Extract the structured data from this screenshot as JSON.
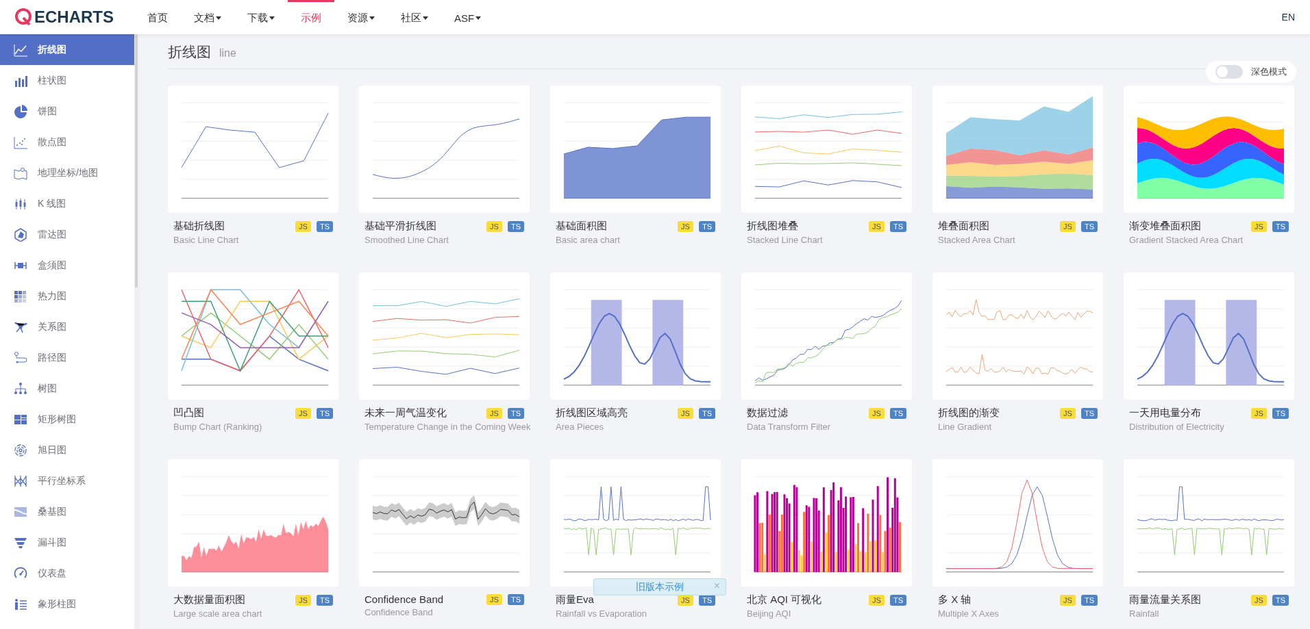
{
  "header": {
    "logo": "ECHARTS",
    "nav": [
      {
        "label": "首页",
        "has_menu": false,
        "selected": false
      },
      {
        "label": "文档",
        "has_menu": true,
        "selected": false
      },
      {
        "label": "下载",
        "has_menu": true,
        "selected": false
      },
      {
        "label": "示例",
        "has_menu": false,
        "selected": true
      },
      {
        "label": "资源",
        "has_menu": true,
        "selected": false
      },
      {
        "label": "社区",
        "has_menu": true,
        "selected": false
      },
      {
        "label": "ASF",
        "has_menu": true,
        "selected": false
      }
    ],
    "language": "EN"
  },
  "sidebar": {
    "items": [
      {
        "label": "折线图",
        "selected": true
      },
      {
        "label": "柱状图",
        "selected": false
      },
      {
        "label": "饼图",
        "selected": false
      },
      {
        "label": "散点图",
        "selected": false
      },
      {
        "label": "地理坐标/地图",
        "selected": false
      },
      {
        "label": "K 线图",
        "selected": false
      },
      {
        "label": "雷达图",
        "selected": false
      },
      {
        "label": "盒须图",
        "selected": false
      },
      {
        "label": "热力图",
        "selected": false
      },
      {
        "label": "关系图",
        "selected": false
      },
      {
        "label": "路径图",
        "selected": false
      },
      {
        "label": "树图",
        "selected": false
      },
      {
        "label": "矩形树图",
        "selected": false
      },
      {
        "label": "旭日图",
        "selected": false
      },
      {
        "label": "平行坐标系",
        "selected": false
      },
      {
        "label": "桑基图",
        "selected": false
      },
      {
        "label": "漏斗图",
        "selected": false
      },
      {
        "label": "仪表盘",
        "selected": false
      },
      {
        "label": "象形柱图",
        "selected": false
      }
    ]
  },
  "section": {
    "title": "折线图",
    "subtitle": "line"
  },
  "dark_mode": {
    "label": "深色模式",
    "on": false
  },
  "cards": [
    {
      "title": "基础折线图",
      "subtitle": "Basic Line Chart",
      "kind": "line",
      "badges": [
        "JS",
        "TS"
      ]
    },
    {
      "title": "基础平滑折线图",
      "subtitle": "Smoothed Line Chart",
      "kind": "smooth",
      "badges": [
        "JS",
        "TS"
      ]
    },
    {
      "title": "基础面积图",
      "subtitle": "Basic area chart",
      "kind": "area",
      "badges": [
        "JS",
        "TS"
      ]
    },
    {
      "title": "折线图堆叠",
      "subtitle": "Stacked Line Chart",
      "kind": "multi",
      "badges": [
        "JS",
        "TS"
      ]
    },
    {
      "title": "堆叠面积图",
      "subtitle": "Stacked Area Chart",
      "kind": "stacked",
      "badges": [
        "JS",
        "TS"
      ]
    },
    {
      "title": "渐变堆叠面积图",
      "subtitle": "Gradient Stacked Area Chart",
      "kind": "waves",
      "badges": [
        "JS",
        "TS"
      ]
    },
    {
      "title": "凹凸图",
      "subtitle": "Bump Chart (Ranking)",
      "kind": "bump",
      "badges": [
        "JS",
        "TS"
      ]
    },
    {
      "title": "未来一周气温变化",
      "subtitle": "Temperature Change in the Coming Week",
      "kind": "multi",
      "badges": [
        "JS",
        "TS"
      ]
    },
    {
      "title": "折线图区域高亮",
      "subtitle": "Area Pieces",
      "kind": "pieces",
      "badges": [
        "JS",
        "TS"
      ]
    },
    {
      "title": "数据过滤",
      "subtitle": "Data Transform Filter",
      "kind": "trend",
      "badges": [
        "JS",
        "TS"
      ]
    },
    {
      "title": "折线图的渐变",
      "subtitle": "Line Gradient",
      "kind": "noise",
      "badges": [
        "JS",
        "TS"
      ]
    },
    {
      "title": "一天用电量分布",
      "subtitle": "Distribution of Electricity",
      "kind": "pieces",
      "badges": [
        "JS",
        "TS"
      ]
    },
    {
      "title": "大数据量面积图",
      "subtitle": "Large scale area chart",
      "kind": "noisearea",
      "badges": [
        "JS",
        "TS"
      ]
    },
    {
      "title": "Confidence Band",
      "subtitle": "Confidence Band",
      "kind": "band",
      "badges": [
        "JS",
        "TS"
      ]
    },
    {
      "title": "雨量Eva",
      "subtitle": "Rainfall vs Evaporation",
      "kind": "spikes",
      "badges": [
        "JS",
        "TS"
      ]
    },
    {
      "title": "北京 AQI 可视化",
      "subtitle": "Beijing AQI",
      "kind": "aqi",
      "badges": [
        "JS",
        "TS"
      ]
    },
    {
      "title": "多 X 轴",
      "subtitle": "Multiple X Axes",
      "kind": "peak",
      "badges": [
        "JS",
        "TS"
      ]
    },
    {
      "title": "雨量流量关系图",
      "subtitle": "Rainfall",
      "kind": "spikes",
      "badges": [
        "JS",
        "TS"
      ]
    }
  ],
  "toast": {
    "text": "旧版本示例",
    "close": "×"
  }
}
